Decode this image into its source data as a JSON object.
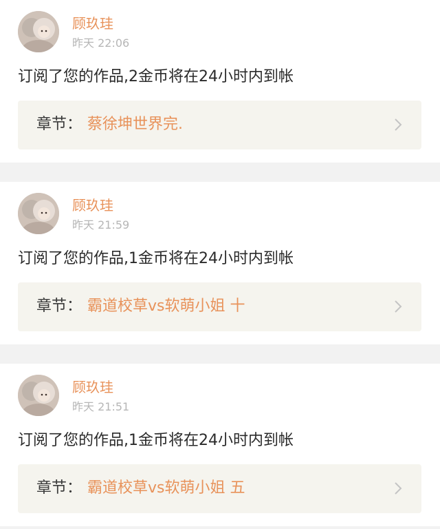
{
  "colors": {
    "accent": "#e8925a",
    "time_gray": "#b6b6b6",
    "chapter_bg": "#f5f4ee",
    "separator": "#f2f2f2"
  },
  "notifications": [
    {
      "username": "顾玖珪",
      "time": "昨天 22:06",
      "message": "订阅了您的作品,2金币将在24小时内到帐",
      "chapter_label": "章节：",
      "chapter_title": "蔡徐坤世界完."
    },
    {
      "username": "顾玖珪",
      "time": "昨天 21:59",
      "message": "订阅了您的作品,1金币将在24小时内到帐",
      "chapter_label": "章节：",
      "chapter_title": "霸道校草vs软萌小姐 十"
    },
    {
      "username": "顾玖珪",
      "time": "昨天 21:51",
      "message": "订阅了您的作品,1金币将在24小时内到帐",
      "chapter_label": "章节：",
      "chapter_title": "霸道校草vs软萌小姐  五"
    }
  ]
}
